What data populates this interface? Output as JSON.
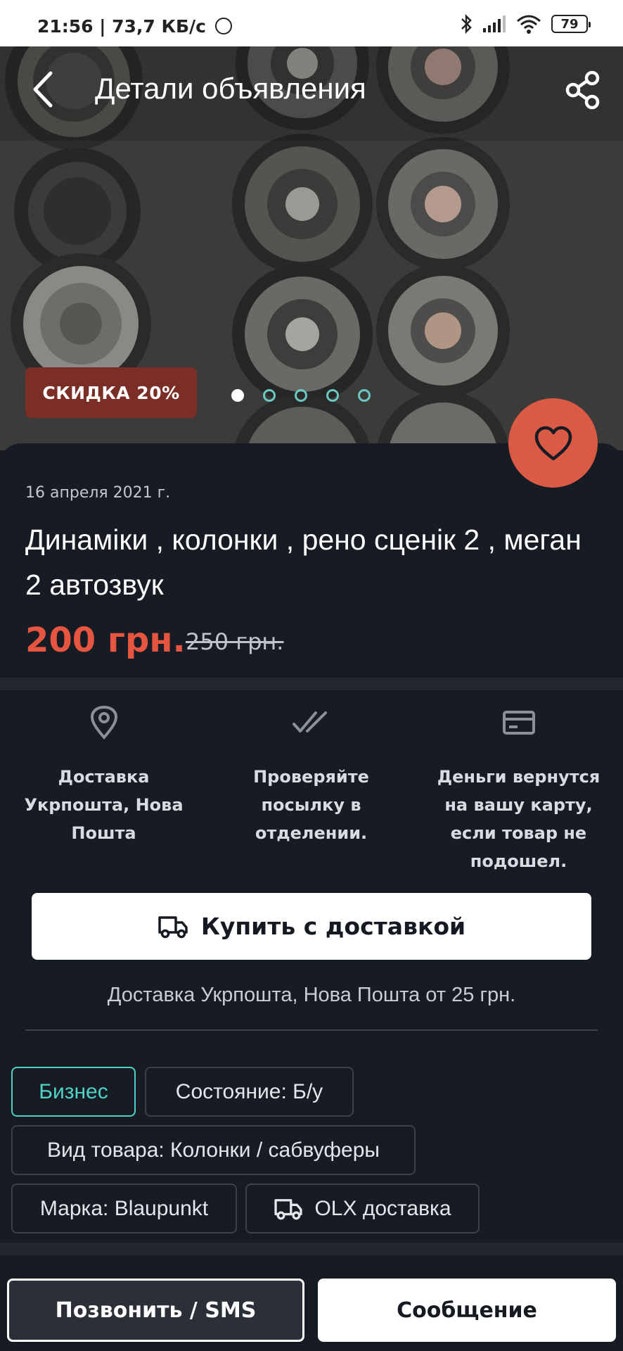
{
  "status_bar": {
    "time": "21:56",
    "network_speed": "| 73,7 КБ/с",
    "battery": "79"
  },
  "header": {
    "title": "Детали объявления"
  },
  "gallery": {
    "discount_badge": "СКИДКА 20%",
    "photo_count": 5,
    "active_photo": 1
  },
  "listing": {
    "date": "16 апреля 2021 г.",
    "title": "Динамiки , колонки , рено сценiк 2 , меган 2 автозвук",
    "price": "200 грн.",
    "old_price": "250 грн."
  },
  "features": [
    {
      "icon": "location-pin-icon",
      "text": "Доставка Укрпошта, Нова Пошта"
    },
    {
      "icon": "double-check-icon",
      "text": "Проверяйте посылку в отделении."
    },
    {
      "icon": "credit-card-icon",
      "text": "Деньги вернутся на вашу карту, если товар не подошел."
    }
  ],
  "buy_button": {
    "label": "Купить с доставкой"
  },
  "delivery_note": "Доставка Укрпошта, Нова Пошта от 25 грн.",
  "tags": {
    "business": "Бизнес",
    "condition": "Состояние: Б/у",
    "type": "Вид товара: Колонки / сабвуферы",
    "brand": "Марка: Blaupunkt",
    "olx_delivery": "OLX доставка"
  },
  "actions": {
    "call": "Позвонить / SMS",
    "message": "Сообщение"
  },
  "colors": {
    "background": "#161b24",
    "accent_price": "#e5553f",
    "favorite": "#da5a45",
    "business_tag": "#4fd1c7",
    "discount_badge": "#7a2e26"
  }
}
